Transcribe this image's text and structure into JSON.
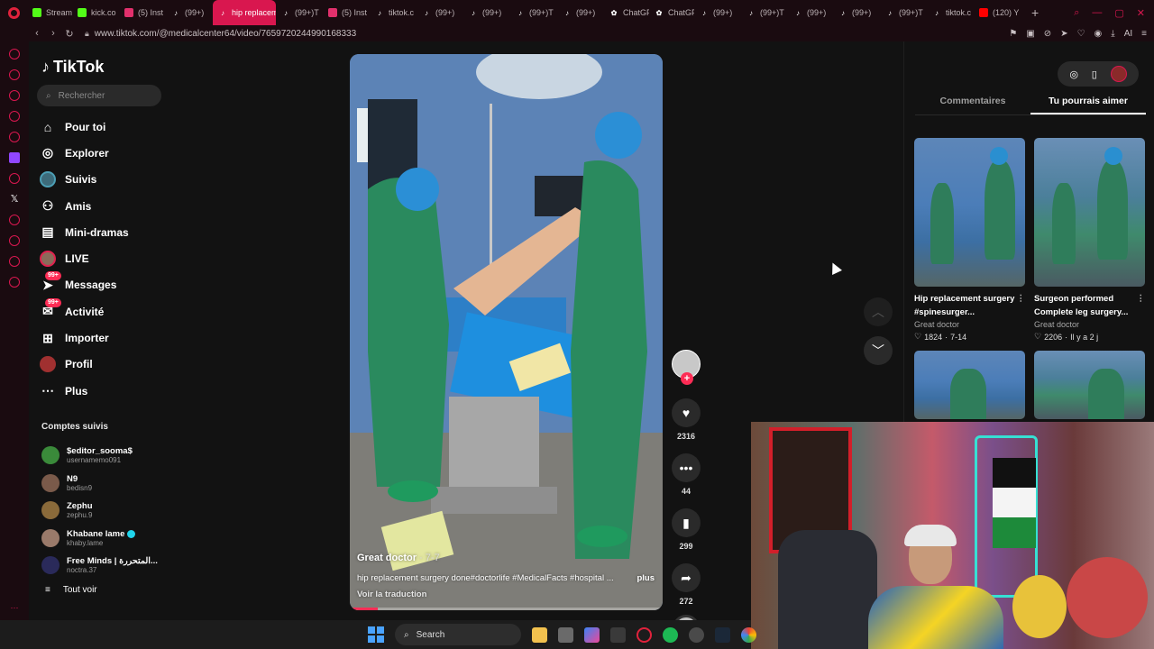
{
  "browser": {
    "tabs": [
      {
        "label": "Stream",
        "icon": "kick-icon",
        "color": "#53fc18"
      },
      {
        "label": "kick.co",
        "icon": "kick-icon",
        "color": "#53fc18"
      },
      {
        "label": "(5) Inst",
        "icon": "instagram-icon",
        "color": "#e1306c"
      },
      {
        "label": "(99+)",
        "icon": "tiktok-icon",
        "color": "#ffffff"
      },
      {
        "label": "hip replaceme",
        "icon": "tiktok-icon",
        "color": "#ffffff",
        "active": true
      },
      {
        "label": "(99+)T",
        "icon": "tiktok-icon",
        "color": "#ffffff"
      },
      {
        "label": "(5) Inst",
        "icon": "instagram-icon",
        "color": "#e1306c"
      },
      {
        "label": "tiktok.c",
        "icon": "tiktok-icon",
        "color": "#ffffff"
      },
      {
        "label": "(99+)",
        "icon": "tiktok-icon",
        "color": "#ffffff"
      },
      {
        "label": "(99+)",
        "icon": "tiktok-icon",
        "color": "#ffffff"
      },
      {
        "label": "(99+)T",
        "icon": "tiktok-icon",
        "color": "#ffffff"
      },
      {
        "label": "(99+)",
        "icon": "tiktok-icon",
        "color": "#ffffff"
      },
      {
        "label": "ChatGF",
        "icon": "chatgpt-icon",
        "color": "#ffffff"
      },
      {
        "label": "ChatGF",
        "icon": "chatgpt-icon",
        "color": "#ffffff"
      },
      {
        "label": "(99+)",
        "icon": "tiktok-icon",
        "color": "#ffffff"
      },
      {
        "label": "(99+)T",
        "icon": "tiktok-icon",
        "color": "#ffffff"
      },
      {
        "label": "(99+)",
        "icon": "tiktok-icon",
        "color": "#ffffff"
      },
      {
        "label": "(99+)",
        "icon": "tiktok-icon",
        "color": "#ffffff"
      },
      {
        "label": "(99+)T",
        "icon": "tiktok-icon",
        "color": "#ffffff"
      },
      {
        "label": "tiktok.c",
        "icon": "tiktok-icon",
        "color": "#ffffff"
      },
      {
        "label": "(120) Y",
        "icon": "youtube-icon",
        "color": "#ff0000"
      }
    ],
    "url": "www.tiktok.com/@medicalcenter64/video/7659720244990168333",
    "ai_label": "AI"
  },
  "tiktok": {
    "brand": "TikTok",
    "search_placeholder": "Rechercher",
    "nav": [
      {
        "label": "Pour toi",
        "icon": "home-icon"
      },
      {
        "label": "Explorer",
        "icon": "compass-icon"
      },
      {
        "label": "Suivis",
        "icon": "following-avatar-icon"
      },
      {
        "label": "Amis",
        "icon": "friends-icon"
      },
      {
        "label": "Mini-dramas",
        "icon": "mini-dramas-icon"
      },
      {
        "label": "LIVE",
        "icon": "live-icon"
      },
      {
        "label": "Messages",
        "icon": "messages-icon",
        "badge": "99+"
      },
      {
        "label": "Activité",
        "icon": "activity-icon",
        "badge": "99+"
      },
      {
        "label": "Importer",
        "icon": "upload-icon"
      },
      {
        "label": "Profil",
        "icon": "profile-avatar-icon"
      },
      {
        "label": "Plus",
        "icon": "more-icon"
      }
    ],
    "following_title": "Comptes suivis",
    "following": [
      {
        "name": "$editor_sooma$",
        "user": "usernamemo091",
        "color": "#3a8a3a"
      },
      {
        "name": "N9",
        "user": "bedisn9",
        "color": "#7a5a4a"
      },
      {
        "name": "Zephu",
        "user": "zephu.9",
        "color": "#8a6a3a"
      },
      {
        "name": "Khabane lame",
        "user": "khaby.lame",
        "color": "#9a7a6a",
        "verified": true
      },
      {
        "name": "Free Minds | المتحررة...",
        "user": "noctra.37",
        "color": "#2a2a5a"
      }
    ],
    "see_all": "Tout voir"
  },
  "video": {
    "author": "Great doctor",
    "date": "· 7-7",
    "caption": "hip replacement surgery done#doctorlife #MedicalFacts #hospital ...",
    "more": "plus",
    "translate": "Voir la traduction",
    "progress": 0.09,
    "likes": "2316",
    "comments": "44",
    "saves": "299",
    "shares": "272"
  },
  "panel": {
    "tabs": [
      "Commentaires",
      "Tu pourrais aimer"
    ],
    "active_tab": "Tu pourrais aimer",
    "cards": [
      {
        "title": "Hip replacement surgery #spinesurger...",
        "author": "Great doctor",
        "likes": "1824",
        "date": "7-14"
      },
      {
        "title": "Surgeon performed Complete leg surgery...",
        "author": "Great doctor",
        "likes": "2206",
        "date": "Il y a 2 j"
      }
    ]
  },
  "taskbar": {
    "search": "Search"
  },
  "colors": {
    "accent": "#fe2c55",
    "opera": "#d9174f",
    "background": "#121212"
  }
}
